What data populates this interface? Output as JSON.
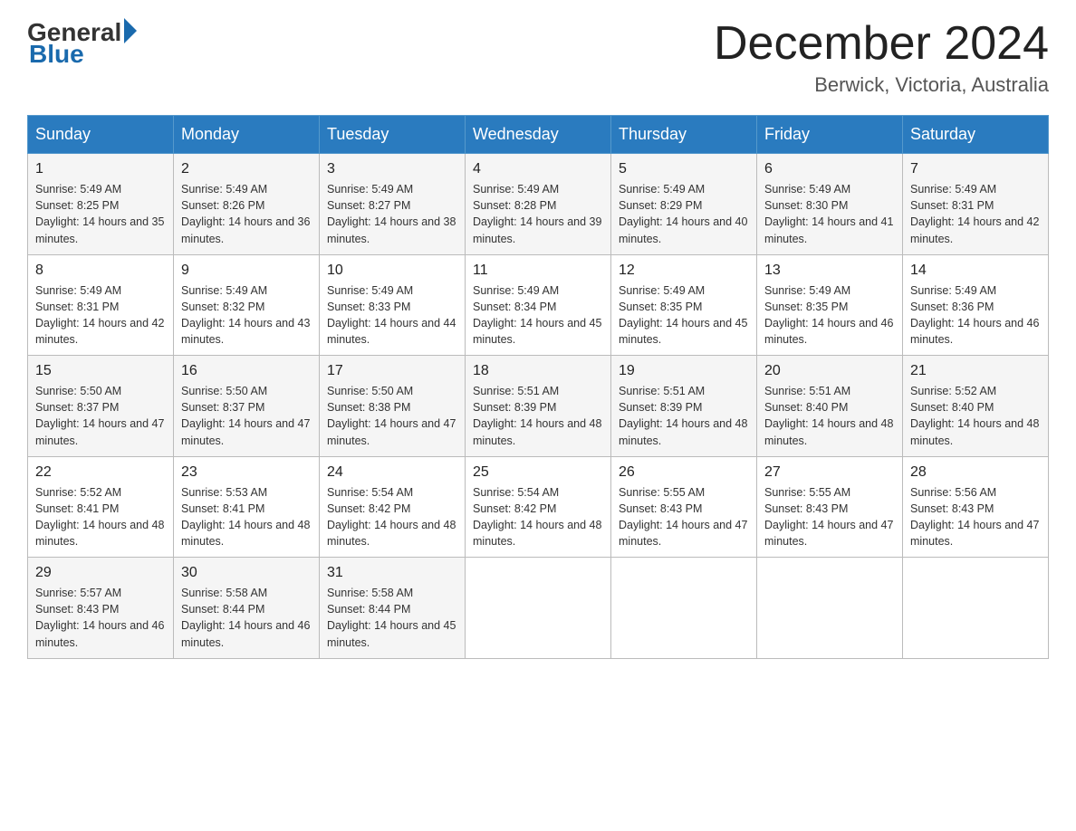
{
  "header": {
    "logo": {
      "general": "General",
      "blue": "Blue"
    },
    "title": "December 2024",
    "location": "Berwick, Victoria, Australia"
  },
  "days_of_week": [
    "Sunday",
    "Monday",
    "Tuesday",
    "Wednesday",
    "Thursday",
    "Friday",
    "Saturday"
  ],
  "weeks": [
    [
      {
        "day": "1",
        "sunrise": "5:49 AM",
        "sunset": "8:25 PM",
        "daylight": "14 hours and 35 minutes."
      },
      {
        "day": "2",
        "sunrise": "5:49 AM",
        "sunset": "8:26 PM",
        "daylight": "14 hours and 36 minutes."
      },
      {
        "day": "3",
        "sunrise": "5:49 AM",
        "sunset": "8:27 PM",
        "daylight": "14 hours and 38 minutes."
      },
      {
        "day": "4",
        "sunrise": "5:49 AM",
        "sunset": "8:28 PM",
        "daylight": "14 hours and 39 minutes."
      },
      {
        "day": "5",
        "sunrise": "5:49 AM",
        "sunset": "8:29 PM",
        "daylight": "14 hours and 40 minutes."
      },
      {
        "day": "6",
        "sunrise": "5:49 AM",
        "sunset": "8:30 PM",
        "daylight": "14 hours and 41 minutes."
      },
      {
        "day": "7",
        "sunrise": "5:49 AM",
        "sunset": "8:31 PM",
        "daylight": "14 hours and 42 minutes."
      }
    ],
    [
      {
        "day": "8",
        "sunrise": "5:49 AM",
        "sunset": "8:31 PM",
        "daylight": "14 hours and 42 minutes."
      },
      {
        "day": "9",
        "sunrise": "5:49 AM",
        "sunset": "8:32 PM",
        "daylight": "14 hours and 43 minutes."
      },
      {
        "day": "10",
        "sunrise": "5:49 AM",
        "sunset": "8:33 PM",
        "daylight": "14 hours and 44 minutes."
      },
      {
        "day": "11",
        "sunrise": "5:49 AM",
        "sunset": "8:34 PM",
        "daylight": "14 hours and 45 minutes."
      },
      {
        "day": "12",
        "sunrise": "5:49 AM",
        "sunset": "8:35 PM",
        "daylight": "14 hours and 45 minutes."
      },
      {
        "day": "13",
        "sunrise": "5:49 AM",
        "sunset": "8:35 PM",
        "daylight": "14 hours and 46 minutes."
      },
      {
        "day": "14",
        "sunrise": "5:49 AM",
        "sunset": "8:36 PM",
        "daylight": "14 hours and 46 minutes."
      }
    ],
    [
      {
        "day": "15",
        "sunrise": "5:50 AM",
        "sunset": "8:37 PM",
        "daylight": "14 hours and 47 minutes."
      },
      {
        "day": "16",
        "sunrise": "5:50 AM",
        "sunset": "8:37 PM",
        "daylight": "14 hours and 47 minutes."
      },
      {
        "day": "17",
        "sunrise": "5:50 AM",
        "sunset": "8:38 PM",
        "daylight": "14 hours and 47 minutes."
      },
      {
        "day": "18",
        "sunrise": "5:51 AM",
        "sunset": "8:39 PM",
        "daylight": "14 hours and 48 minutes."
      },
      {
        "day": "19",
        "sunrise": "5:51 AM",
        "sunset": "8:39 PM",
        "daylight": "14 hours and 48 minutes."
      },
      {
        "day": "20",
        "sunrise": "5:51 AM",
        "sunset": "8:40 PM",
        "daylight": "14 hours and 48 minutes."
      },
      {
        "day": "21",
        "sunrise": "5:52 AM",
        "sunset": "8:40 PM",
        "daylight": "14 hours and 48 minutes."
      }
    ],
    [
      {
        "day": "22",
        "sunrise": "5:52 AM",
        "sunset": "8:41 PM",
        "daylight": "14 hours and 48 minutes."
      },
      {
        "day": "23",
        "sunrise": "5:53 AM",
        "sunset": "8:41 PM",
        "daylight": "14 hours and 48 minutes."
      },
      {
        "day": "24",
        "sunrise": "5:54 AM",
        "sunset": "8:42 PM",
        "daylight": "14 hours and 48 minutes."
      },
      {
        "day": "25",
        "sunrise": "5:54 AM",
        "sunset": "8:42 PM",
        "daylight": "14 hours and 48 minutes."
      },
      {
        "day": "26",
        "sunrise": "5:55 AM",
        "sunset": "8:43 PM",
        "daylight": "14 hours and 47 minutes."
      },
      {
        "day": "27",
        "sunrise": "5:55 AM",
        "sunset": "8:43 PM",
        "daylight": "14 hours and 47 minutes."
      },
      {
        "day": "28",
        "sunrise": "5:56 AM",
        "sunset": "8:43 PM",
        "daylight": "14 hours and 47 minutes."
      }
    ],
    [
      {
        "day": "29",
        "sunrise": "5:57 AM",
        "sunset": "8:43 PM",
        "daylight": "14 hours and 46 minutes."
      },
      {
        "day": "30",
        "sunrise": "5:58 AM",
        "sunset": "8:44 PM",
        "daylight": "14 hours and 46 minutes."
      },
      {
        "day": "31",
        "sunrise": "5:58 AM",
        "sunset": "8:44 PM",
        "daylight": "14 hours and 45 minutes."
      },
      null,
      null,
      null,
      null
    ]
  ]
}
